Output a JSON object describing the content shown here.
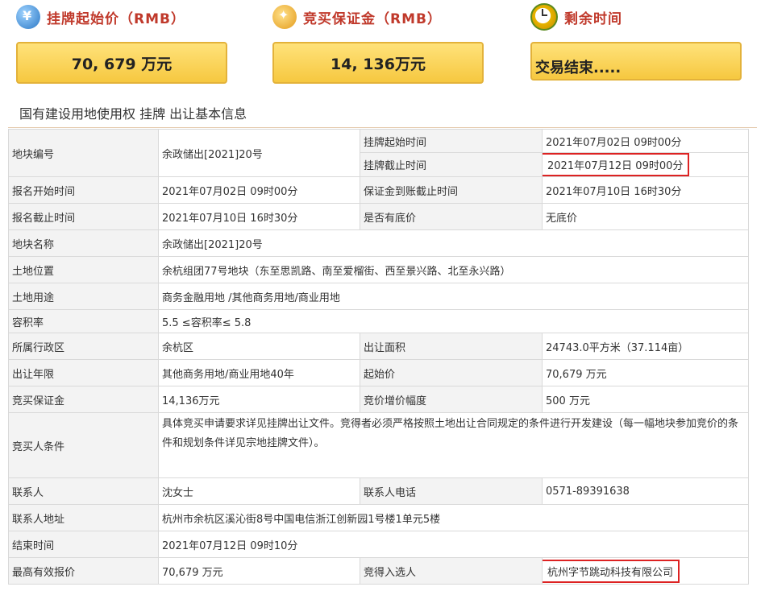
{
  "summary": {
    "start_price": {
      "title": "挂牌起始价（RMB）",
      "value": "70, 679  万元",
      "icon": "price-icon"
    },
    "deposit": {
      "title": "竞买保证金（RMB）",
      "value": "14, 136万元",
      "icon": "deposit-icon"
    },
    "remaining": {
      "title": "剩余时间",
      "value": "交易结束.....",
      "icon": "clock-icon"
    }
  },
  "section_title": "国有建设用地使用权  挂牌  出让基本信息",
  "table": {
    "parcel_no": {
      "label": "地块编号",
      "value": "余政储出[2021]20号"
    },
    "listing_start": {
      "label": "挂牌起始时间",
      "value": "2021年07月02日  09时00分"
    },
    "listing_end": {
      "label": "挂牌截止时间",
      "value": "2021年07月12日  09时00分"
    },
    "reg_start": {
      "label": "报名开始时间",
      "value": "2021年07月02日  09时00分"
    },
    "deposit_deadline": {
      "label": "保证金到账截止时间",
      "value": "2021年07月10日  16时30分"
    },
    "reg_end": {
      "label": "报名截止时间",
      "value": "2021年07月10日  16时30分"
    },
    "reserve": {
      "label": "是否有底价",
      "value": "无底价"
    },
    "parcel_name": {
      "label": "地块名称",
      "value": "余政储出[2021]20号"
    },
    "location": {
      "label": "土地位置",
      "value": "余杭组团77号地块（东至思凯路、南至爱榴街、西至景兴路、北至永兴路）"
    },
    "usage": {
      "label": "土地用途",
      "value": "商务金融用地 /其他商务用地/商业用地"
    },
    "far": {
      "label": "容积率",
      "value": "5.5  ≤容积率≤  5.8"
    },
    "district": {
      "label": "所属行政区",
      "value": "余杭区"
    },
    "area": {
      "label": "出让面积",
      "value": "24743.0平方米（37.114亩）"
    },
    "term": {
      "label": "出让年限",
      "value": "其他商务用地/商业用地40年"
    },
    "start_price": {
      "label": "起始价",
      "value": "70,679  万元"
    },
    "bid_deposit": {
      "label": "竞买保证金",
      "value": "14,136万元"
    },
    "increment": {
      "label": "竞价增价幅度",
      "value": "500  万元"
    },
    "conditions": {
      "label": "竞买人条件",
      "value": "具体竞买申请要求详见挂牌出让文件。竞得者必须严格按照土地出让合同规定的条件进行开发建设（每一幅地块参加竞价的条件和规划条件详见宗地挂牌文件）。"
    },
    "contact": {
      "label": "联系人",
      "value": "沈女士"
    },
    "phone": {
      "label": "联系人电话",
      "value": "0571-89391638"
    },
    "address": {
      "label": "联系人地址",
      "value": "杭州市余杭区溪沁街8号中国电信浙江创新园1号楼1单元5楼"
    },
    "end_time": {
      "label": "结束时间",
      "value": "2021年07月12日  09时10分"
    },
    "top_bid": {
      "label": "最高有效报价",
      "value": "70,679  万元"
    },
    "winner": {
      "label": "竞得入选人",
      "value": "杭州字节跳动科技有限公司"
    }
  }
}
